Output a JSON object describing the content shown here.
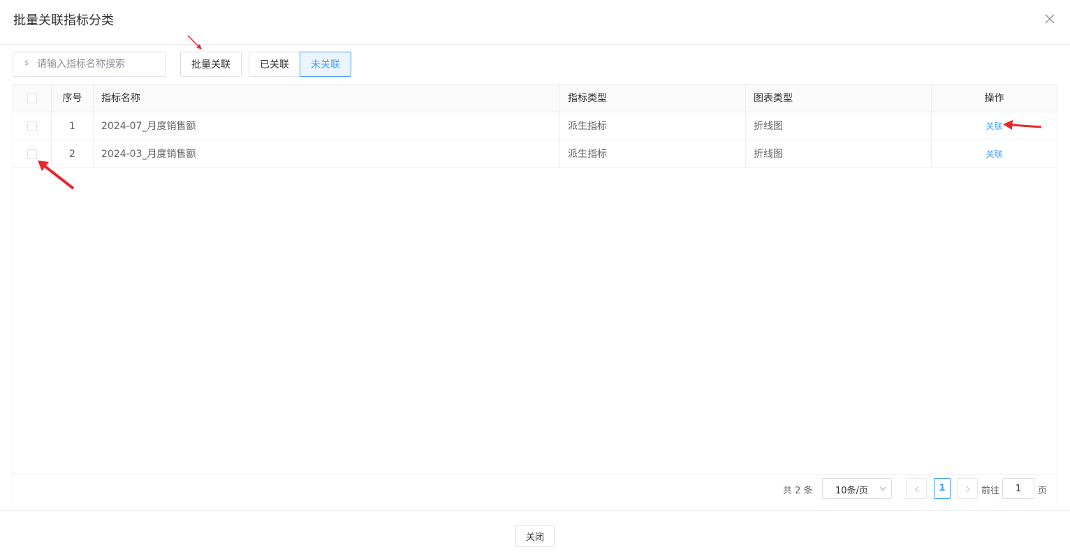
{
  "dialog": {
    "title": "批量关联指标分类"
  },
  "toolbar": {
    "search_prefix": "$",
    "search_placeholder": "请输入指标名称搜索",
    "search_value": "",
    "batch_label": "批量关联",
    "linked_label": "已关联",
    "unlinked_label": "未关联",
    "active_filter": "未关联"
  },
  "table": {
    "headers": {
      "index": "序号",
      "name": "指标名称",
      "type": "指标类型",
      "chart_type": "图表类型",
      "action": "操作"
    },
    "rows": [
      {
        "index": "1",
        "name": "2024-07_月度销售额",
        "type": "派生指标",
        "chart_type": "折线图",
        "action": "关联",
        "checked": false
      },
      {
        "index": "2",
        "name": "2024-03_月度销售额",
        "type": "派生指标",
        "chart_type": "折线图",
        "action": "关联",
        "checked": false
      }
    ]
  },
  "pagination": {
    "total_text": "共 2 条",
    "page_size": "10条/页",
    "current_page": "1",
    "goto_label": "前往",
    "goto_value": "1",
    "goto_suffix": "页"
  },
  "footer": {
    "close_label": "关闭"
  },
  "icons": {
    "close": "close-icon",
    "search_prefix": "dollar-icon",
    "select_arrow": "chevron-down-icon",
    "prev": "chevron-left-icon",
    "next": "chevron-right-icon"
  },
  "colors": {
    "accent": "#409eff",
    "annotation": "#e8262b"
  }
}
